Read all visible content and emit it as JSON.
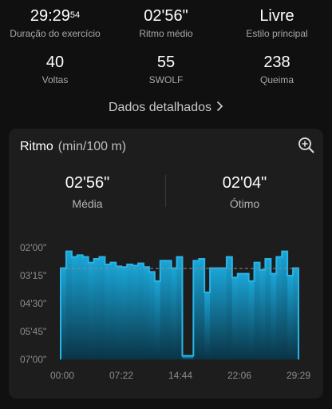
{
  "stats": {
    "duration": {
      "value": "29:29",
      "seconds": "54",
      "label": "Duração do exercício"
    },
    "pace": {
      "value": "02'56\"",
      "label": "Ritmo médio"
    },
    "style": {
      "value": "Livre",
      "label": "Estilo principal"
    },
    "laps": {
      "value": "40",
      "label": "Voltas"
    },
    "swolf": {
      "value": "55",
      "label": "SWOLF"
    },
    "calories": {
      "value": "238",
      "label": "Queima"
    }
  },
  "details_link": "Dados detalhados",
  "card": {
    "title": "Ritmo",
    "unit": "(min/100 m)",
    "average": {
      "value": "02'56\"",
      "label": "Média"
    },
    "best": {
      "value": "02'04\"",
      "label": "Ótimo"
    }
  },
  "chart_data": {
    "type": "bar",
    "title": "Ritmo",
    "ylabel": "(min/100 m)",
    "y_axis_inverted": true,
    "ylim_seconds": [
      120,
      420
    ],
    "yticks": [
      "02'00\"",
      "03'15\"",
      "04'30\"",
      "05'45\"",
      "07'00\""
    ],
    "xticks": [
      "00:00",
      "07:22",
      "14:44",
      "22:06",
      "29:29"
    ],
    "average_seconds": 176,
    "values_seconds": [
      175,
      130,
      145,
      140,
      145,
      160,
      150,
      145,
      165,
      160,
      170,
      172,
      165,
      168,
      162,
      172,
      185,
      210,
      155,
      155,
      175,
      145,
      410,
      410,
      155,
      150,
      240,
      175,
      175,
      175,
      145,
      200,
      190,
      190,
      210,
      160,
      180,
      150,
      190,
      145,
      130,
      195,
      175
    ],
    "colors": {
      "bar_top": "#1aa5d6",
      "bar_bottom": "#0a3446",
      "outline": "#29b4e8",
      "avg_line": "#8a8a8a"
    }
  }
}
